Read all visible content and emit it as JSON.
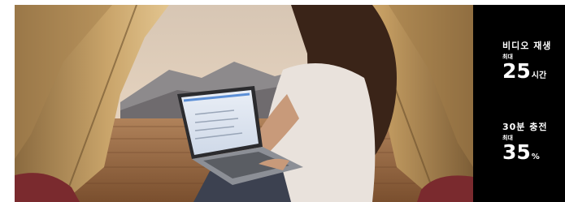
{
  "stats": [
    {
      "label": "비디오 재생",
      "sub": "최대",
      "value": "25",
      "unit": "시간"
    },
    {
      "label": "30분 충전",
      "sub": "최대",
      "value": "35",
      "unit": "%"
    }
  ],
  "colors": {
    "panel": "#000000",
    "text": "#ffffff",
    "tent_fabric": "#c9a46a",
    "sky": "#e8d6c2",
    "deck": "#9a6b45"
  }
}
